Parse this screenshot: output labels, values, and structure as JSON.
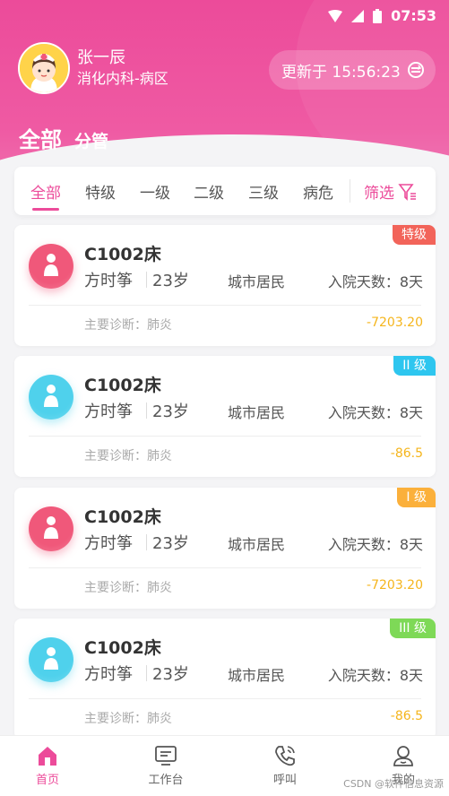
{
  "status_bar": {
    "time": "07:53"
  },
  "profile": {
    "name": "张一辰",
    "department": "消化内科-病区"
  },
  "update": {
    "label": "更新于 15:56:23"
  },
  "top_tabs": {
    "all": "全部",
    "group": "分管"
  },
  "filters": {
    "items": [
      "全部",
      "特级",
      "一级",
      "二级",
      "三级",
      "病危"
    ],
    "active_index": 0,
    "filter_label": "筛选"
  },
  "patients": [
    {
      "bed": "C1002床",
      "name": "方时筝",
      "age": "23岁",
      "insurance": "城市居民",
      "days": "入院天数：8天",
      "diagnosis": "主要诊断：肺炎",
      "amount": "-7203.20",
      "badge": "特级",
      "badge_color": "#f2645a",
      "avatar_color": "#f0587a"
    },
    {
      "bed": "C1002床",
      "name": "方时筝",
      "age": "23岁",
      "insurance": "城市居民",
      "days": "入院天数：8天",
      "diagnosis": "主要诊断：肺炎",
      "amount": "-86.5",
      "badge": "II 级",
      "badge_color": "#2ec6ef",
      "avatar_color": "#4fd1ec"
    },
    {
      "bed": "C1002床",
      "name": "方时筝",
      "age": "23岁",
      "insurance": "城市居民",
      "days": "入院天数：8天",
      "diagnosis": "主要诊断：肺炎",
      "amount": "-7203.20",
      "badge": "I 级",
      "badge_color": "#fbb03b",
      "avatar_color": "#f0587a"
    },
    {
      "bed": "C1002床",
      "name": "方时筝",
      "age": "23岁",
      "insurance": "城市居民",
      "days": "入院天数：8天",
      "diagnosis": "主要诊断：肺炎",
      "amount": "-86.5",
      "badge": "III 级",
      "badge_color": "#7ed957",
      "avatar_color": "#4fd1ec"
    }
  ],
  "tabbar": [
    {
      "label": "首页",
      "icon": "home-icon"
    },
    {
      "label": "工作台",
      "icon": "workbench-icon"
    },
    {
      "label": "呼叫",
      "icon": "phone-icon"
    },
    {
      "label": "我的",
      "icon": "user-icon"
    }
  ],
  "watermark": "CSDN @软件信息资源"
}
